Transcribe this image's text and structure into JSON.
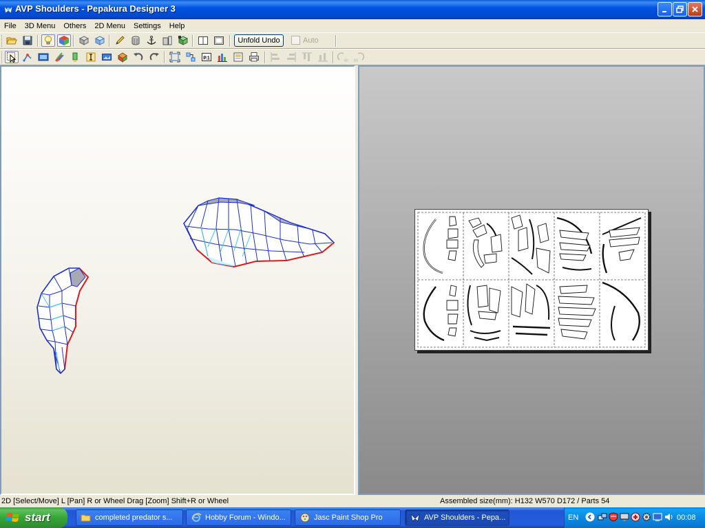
{
  "window": {
    "title": "AVP Shoulders - Pepakura Designer 3"
  },
  "menu": {
    "items": [
      "File",
      "3D Menu",
      "Others",
      "2D Menu",
      "Settings",
      "Help"
    ]
  },
  "toolbar": {
    "unfold_undo_label": "Unfold Undo",
    "auto_label": "Auto",
    "auto_checked": false,
    "row1_icons": [
      "open-folder",
      "save",
      "lightbulb",
      "colored-cube",
      "box-shaded",
      "box-textured",
      "pencil",
      "cylinder",
      "anchor",
      "cube-split",
      "cube-green",
      "single-pane",
      "split-pane"
    ],
    "row2_icons": [
      "select-arrow",
      "edit-node",
      "film-strip",
      "paint",
      "pin",
      "text-i",
      "image",
      "shape-3d",
      "rotate-left",
      "rotate-right",
      "fit-page",
      "arrange",
      "page-number",
      "layout-tiles",
      "print-preview",
      "print",
      "align-left",
      "align-center",
      "align-top",
      "align-bottom"
    ],
    "rotate_90_label": "90",
    "rotate_ccw_label": "90",
    "page_number_label": "P.1"
  },
  "status": {
    "left": "2D [Select/Move] L [Pan] R or Wheel Drag [Zoom] Shift+R or Wheel",
    "right": "Assembled size(mm): H132 W570 D172 / Parts 54"
  },
  "taskbar": {
    "start_label": "start",
    "tasks": [
      {
        "label": "completed predator s...",
        "icon": "folder-icon",
        "active": false
      },
      {
        "label": "Hobby Forum - Windo...",
        "icon": "ie-icon",
        "active": false
      },
      {
        "label": "Jasc Paint Shop Pro",
        "icon": "psp-icon",
        "active": false
      },
      {
        "label": "AVP Shoulders - Pepa...",
        "icon": "pepakura-icon",
        "active": true
      }
    ],
    "language": "EN",
    "clock": "00:08"
  }
}
